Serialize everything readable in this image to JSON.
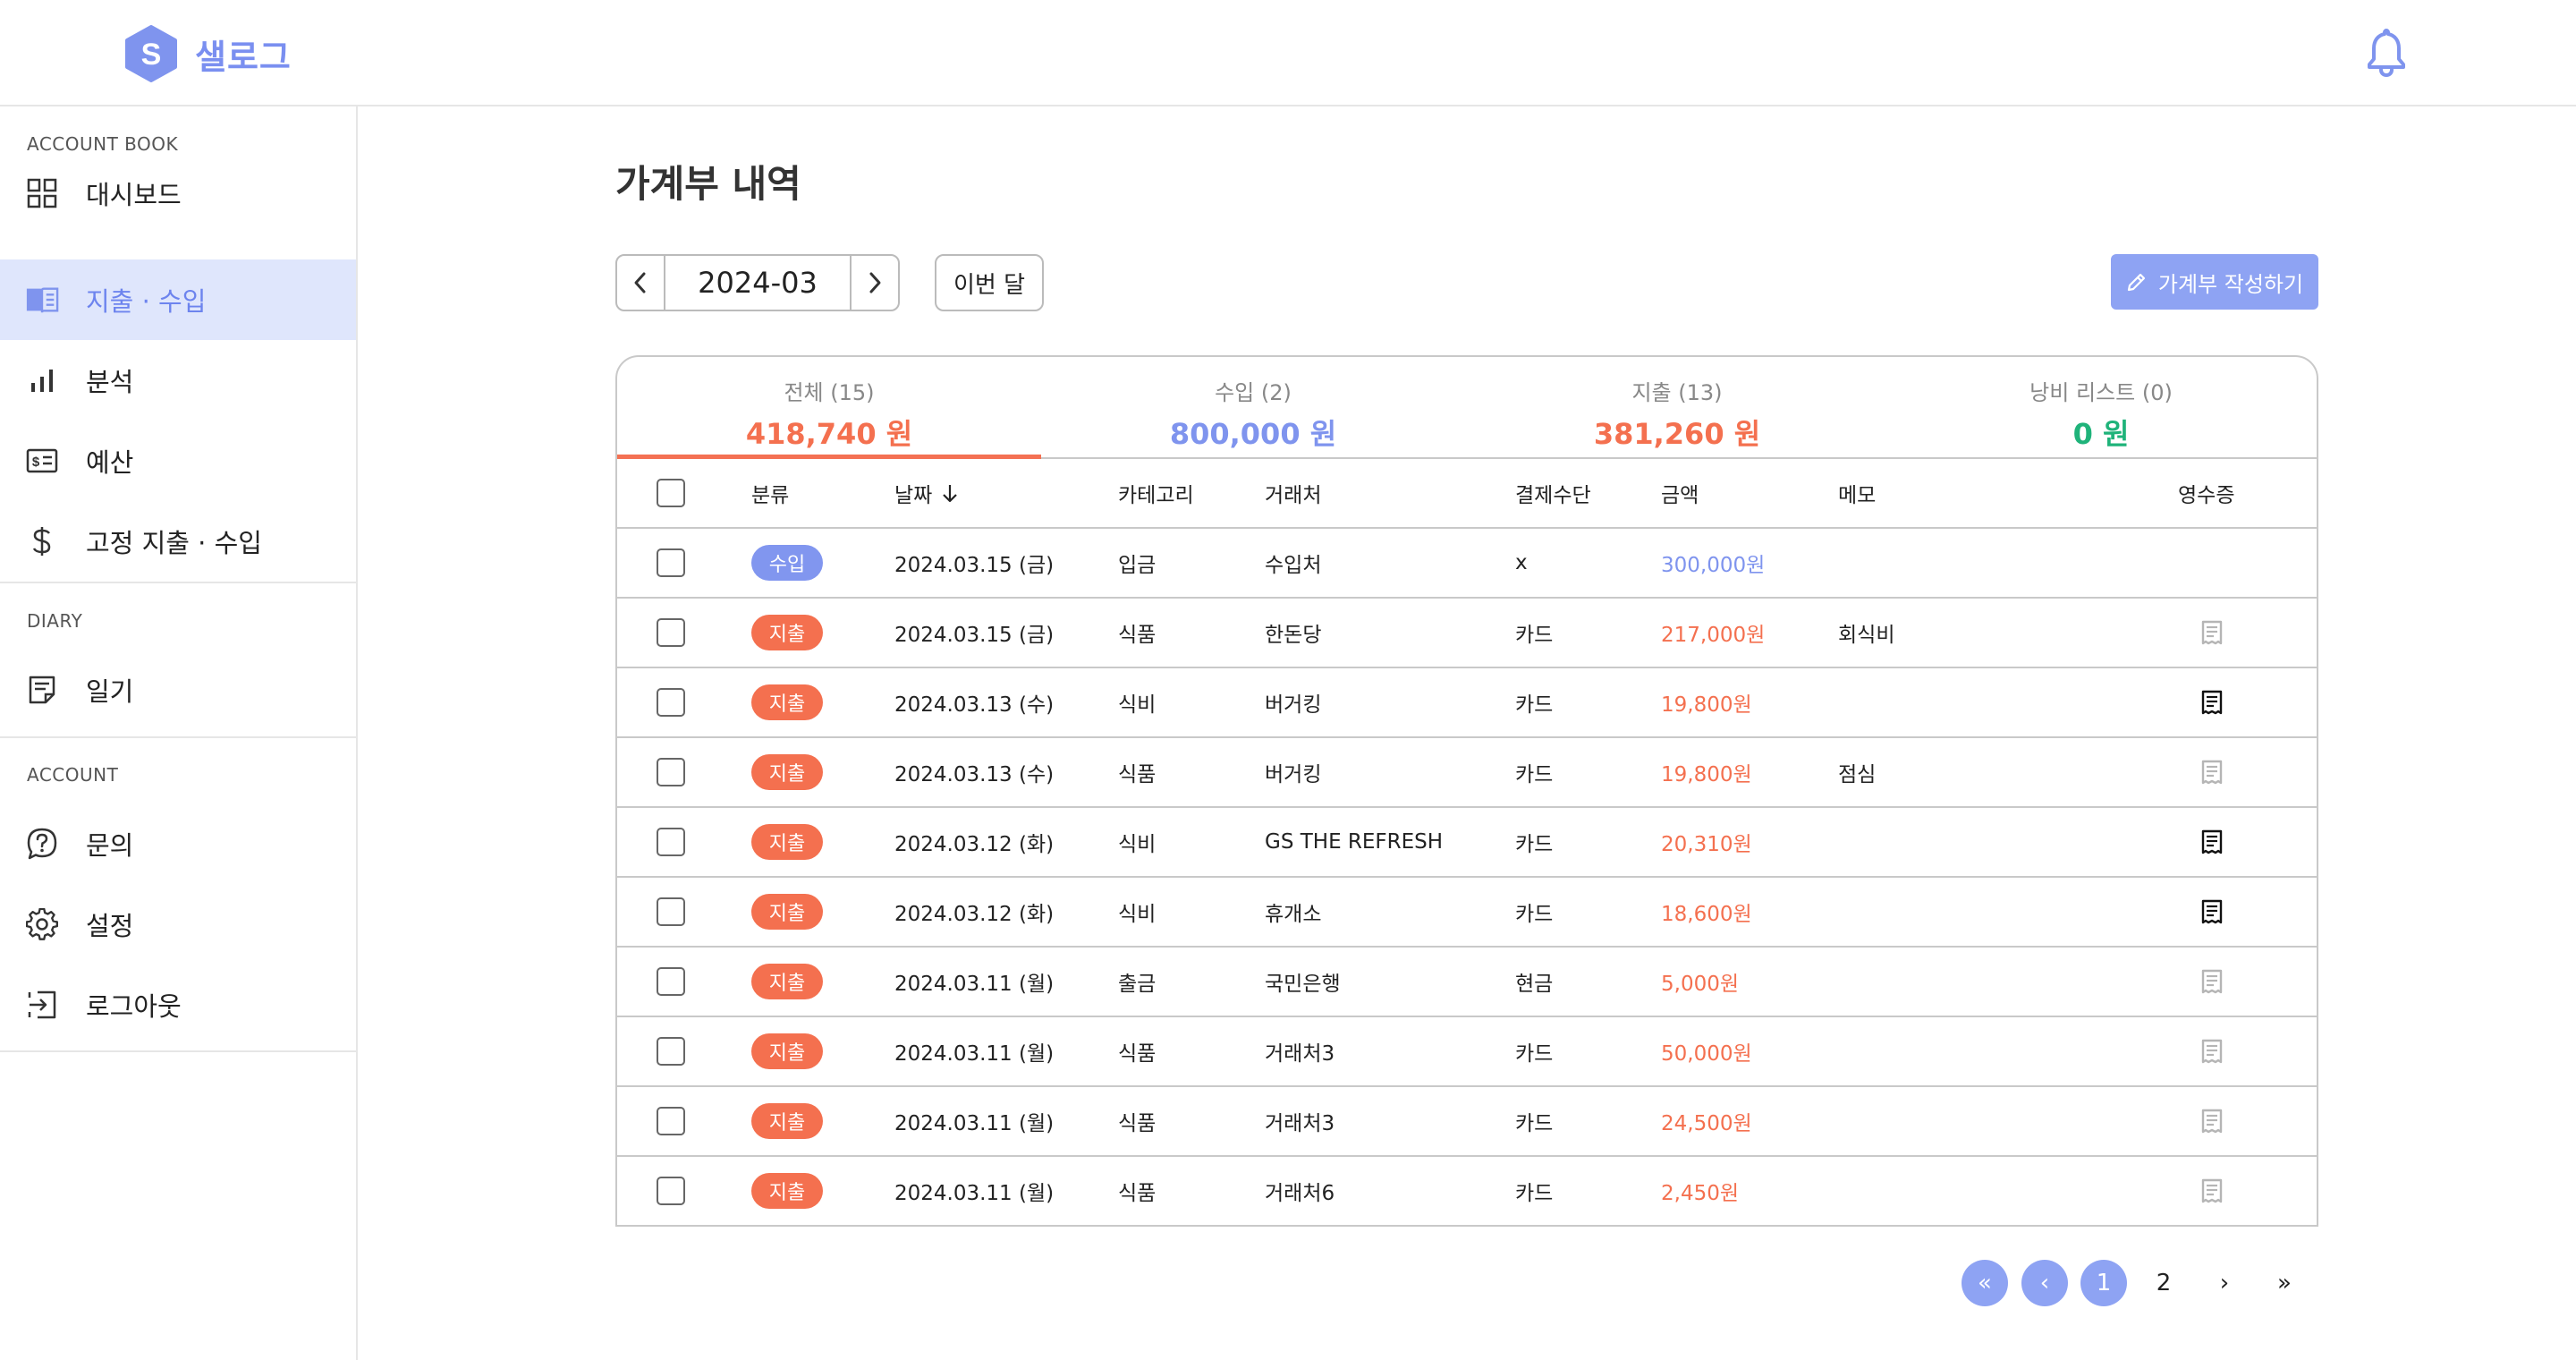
{
  "app": {
    "name": "샐로그",
    "logo_letter": "S"
  },
  "header": {
    "bell_icon": "bell-icon"
  },
  "sidebar": {
    "sections": [
      {
        "label": "ACCOUNT BOOK",
        "items": [
          {
            "label": "대시보드",
            "icon": "grid-icon",
            "active": false
          },
          {
            "label": "지출 · 수입",
            "icon": "book-icon",
            "active": true
          },
          {
            "label": "분석",
            "icon": "bar-chart-icon",
            "active": false
          },
          {
            "label": "예산",
            "icon": "budget-icon",
            "active": false
          },
          {
            "label": "고정 지출 · 수입",
            "icon": "dollar-icon",
            "active": false
          }
        ]
      },
      {
        "label": "DIARY",
        "items": [
          {
            "label": "일기",
            "icon": "note-icon",
            "active": false
          }
        ]
      },
      {
        "label": "ACCOUNT",
        "items": [
          {
            "label": "문의",
            "icon": "question-icon",
            "active": false
          },
          {
            "label": "설정",
            "icon": "gear-icon",
            "active": false
          },
          {
            "label": "로그아웃",
            "icon": "logout-icon",
            "active": false
          }
        ]
      }
    ]
  },
  "main": {
    "title": "가계부 내역",
    "month": "2024-03",
    "this_month_label": "이번 달",
    "write_label": "가계부 작성하기",
    "tabs": [
      {
        "label": "전체 (15)",
        "amount": "418,740 원",
        "color": "#f4704f",
        "active": true
      },
      {
        "label": "수입 (2)",
        "amount": "800,000 원",
        "color": "#7f94ee",
        "active": false
      },
      {
        "label": "지출 (13)",
        "amount": "381,260 원",
        "color": "#f4704f",
        "active": false
      },
      {
        "label": "낭비 리스트 (0)",
        "amount": "0 원",
        "color": "#1fb37a",
        "active": false
      }
    ],
    "columns": {
      "type": "분류",
      "date": "날짜",
      "category": "카테고리",
      "merchant": "거래처",
      "payment": "결제수단",
      "amount": "금액",
      "memo": "메모",
      "receipt": "영수증"
    },
    "rows": [
      {
        "type": "수입",
        "kind": "income",
        "date": "2024.03.15 (금)",
        "category": "입금",
        "merchant": "수입처",
        "payment": "x",
        "amount": "300,000원",
        "memo": "",
        "receipt": "none"
      },
      {
        "type": "지출",
        "kind": "expense",
        "date": "2024.03.15 (금)",
        "category": "식품",
        "merchant": "한돈당",
        "payment": "카드",
        "amount": "217,000원",
        "memo": "회식비",
        "receipt": "empty"
      },
      {
        "type": "지출",
        "kind": "expense",
        "date": "2024.03.13 (수)",
        "category": "식비",
        "merchant": "버거킹",
        "payment": "카드",
        "amount": "19,800원",
        "memo": "",
        "receipt": "attached"
      },
      {
        "type": "지출",
        "kind": "expense",
        "date": "2024.03.13 (수)",
        "category": "식품",
        "merchant": "버거킹",
        "payment": "카드",
        "amount": "19,800원",
        "memo": "점심",
        "receipt": "empty"
      },
      {
        "type": "지출",
        "kind": "expense",
        "date": "2024.03.12 (화)",
        "category": "식비",
        "merchant": "GS THE REFRESH",
        "payment": "카드",
        "amount": "20,310원",
        "memo": "",
        "receipt": "attached"
      },
      {
        "type": "지출",
        "kind": "expense",
        "date": "2024.03.12 (화)",
        "category": "식비",
        "merchant": "휴개소",
        "payment": "카드",
        "amount": "18,600원",
        "memo": "",
        "receipt": "attached"
      },
      {
        "type": "지출",
        "kind": "expense",
        "date": "2024.03.11 (월)",
        "category": "출금",
        "merchant": "국민은행",
        "payment": "현금",
        "amount": "5,000원",
        "memo": "",
        "receipt": "empty"
      },
      {
        "type": "지출",
        "kind": "expense",
        "date": "2024.03.11 (월)",
        "category": "식품",
        "merchant": "거래처3",
        "payment": "카드",
        "amount": "50,000원",
        "memo": "",
        "receipt": "empty"
      },
      {
        "type": "지출",
        "kind": "expense",
        "date": "2024.03.11 (월)",
        "category": "식품",
        "merchant": "거래처3",
        "payment": "카드",
        "amount": "24,500원",
        "memo": "",
        "receipt": "empty"
      },
      {
        "type": "지출",
        "kind": "expense",
        "date": "2024.03.11 (월)",
        "category": "식품",
        "merchant": "거래처6",
        "payment": "카드",
        "amount": "2,450원",
        "memo": "",
        "receipt": "empty"
      }
    ]
  },
  "pagination": {
    "first": "«",
    "prev": "‹",
    "next": "›",
    "last": "»",
    "pages": [
      "1",
      "2"
    ],
    "current": "1"
  },
  "colors": {
    "accent": "#8ea3f3",
    "income": "#7f94ee",
    "expense": "#f4704f",
    "waste": "#1fb37a"
  }
}
